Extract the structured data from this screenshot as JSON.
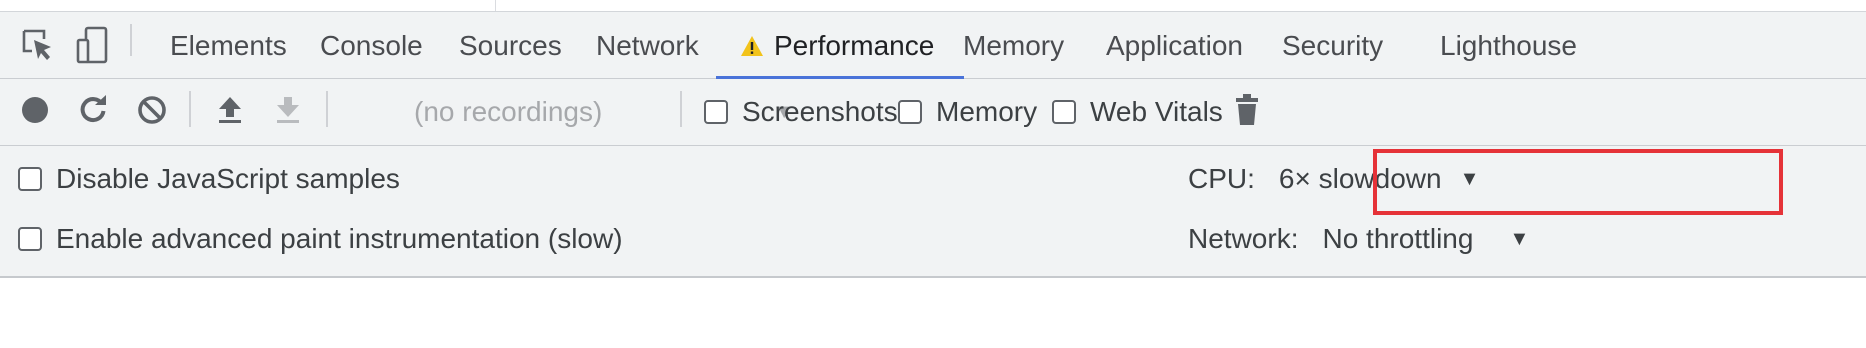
{
  "tabs": [
    {
      "label": "Elements",
      "active": false
    },
    {
      "label": "Console",
      "active": false
    },
    {
      "label": "Sources",
      "active": false
    },
    {
      "label": "Network",
      "active": false
    },
    {
      "label": "Performance",
      "active": true,
      "warning": true
    },
    {
      "label": "Memory",
      "active": false
    },
    {
      "label": "Application",
      "active": false
    },
    {
      "label": "Security",
      "active": false
    },
    {
      "label": "Lighthouse",
      "active": false
    }
  ],
  "toolbar": {
    "recordings_placeholder": "(no recordings)",
    "checkboxes": [
      {
        "label": "Screenshots",
        "checked": false
      },
      {
        "label": "Memory",
        "checked": false
      },
      {
        "label": "Web Vitals",
        "checked": false
      }
    ]
  },
  "settings": {
    "disable_js_samples": {
      "label": "Disable JavaScript samples",
      "checked": false
    },
    "advanced_paint": {
      "label": "Enable advanced paint instrumentation (slow)",
      "checked": false
    },
    "cpu": {
      "label": "CPU:",
      "value": "6× slowdown"
    },
    "network": {
      "label": "Network:",
      "value": "No throttling"
    }
  },
  "icons": {
    "inspect": "inspect-element-icon",
    "device": "device-toolbar-icon",
    "warning": "warning-icon",
    "record": "record-icon",
    "reload": "reload-record-icon",
    "clear": "clear-icon",
    "upload": "load-profile-icon",
    "download": "save-profile-icon",
    "trash": "trash-icon"
  },
  "colors": {
    "active_tab_underline": "#4a73d9",
    "highlight_border": "#e53238",
    "warning": "#f2c31b"
  }
}
